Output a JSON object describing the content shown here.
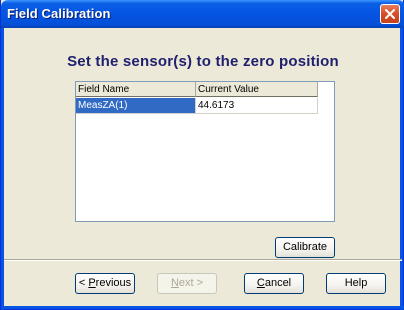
{
  "window": {
    "title": "Field Calibration"
  },
  "main": {
    "heading": "Set the sensor(s) to the zero position",
    "grid": {
      "columns": [
        "Field Name",
        "Current Value"
      ],
      "rows": [
        {
          "field_name": "MeasZA(1)",
          "current_value": "44.6173"
        }
      ]
    },
    "calibrate_label": "Calibrate"
  },
  "footer": {
    "previous_prefix": "< ",
    "previous_accel": "P",
    "previous_rest": "revious",
    "next_accel": "N",
    "next_rest": "ext >",
    "cancel_accel": "C",
    "cancel_rest": "ancel",
    "help_label": "Help"
  },
  "icons": {
    "close": "close-icon"
  },
  "colors": {
    "titlebar": "#0554E3",
    "selection": "#316AC5",
    "heading": "#1F1F6E"
  }
}
